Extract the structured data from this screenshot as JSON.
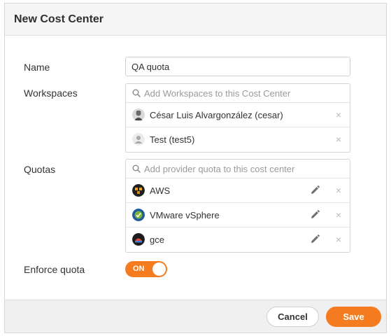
{
  "dialog": {
    "title": "New Cost Center"
  },
  "form": {
    "name_label": "Name",
    "name_value": "QA quota",
    "workspaces_label": "Workspaces",
    "workspaces_placeholder": "Add Workspaces to this Cost Center",
    "workspaces": [
      {
        "label": "César Luis Alvargonzález (cesar)",
        "icon": "user-photo-avatar"
      },
      {
        "label": "Test (test5)",
        "icon": "default-user-avatar"
      }
    ],
    "quotas_label": "Quotas",
    "quotas_placeholder": "Add provider quota to this cost center",
    "quotas": [
      {
        "label": "AWS",
        "icon": "aws-provider-icon"
      },
      {
        "label": "VMware vSphere",
        "icon": "vmware-provider-icon"
      },
      {
        "label": "gce",
        "icon": "gce-provider-icon"
      }
    ],
    "enforce_label": "Enforce quota",
    "enforce_toggle_text": "ON",
    "remove_symbol": "×"
  },
  "footer": {
    "cancel_label": "Cancel",
    "save_label": "Save"
  },
  "colors": {
    "accent": "#f47b20"
  }
}
